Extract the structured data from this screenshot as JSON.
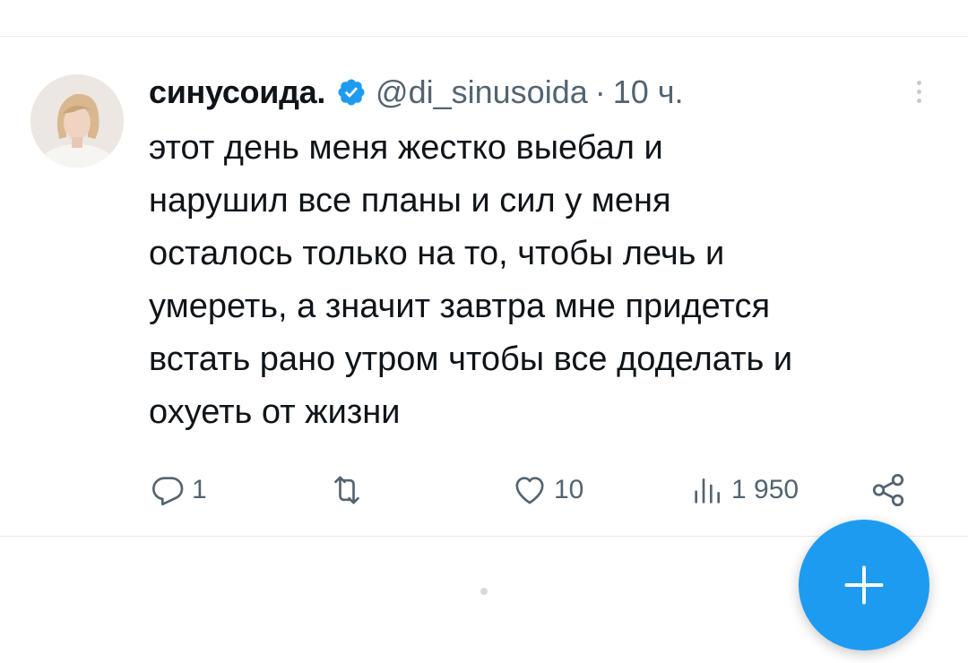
{
  "tweet": {
    "author": {
      "display_name": "синусоида.",
      "handle": "@di_sinusoida",
      "verified": true
    },
    "separator": "·",
    "time": "10 ч.",
    "text_lines": [
      "этот день меня жестко выебал и",
      "нарушил все планы и сил у меня",
      "осталось только на то, чтобы лечь и",
      "умереть, а значит завтра мне придется",
      "встать рано утром чтобы все доделать и",
      "охуеть от жизни"
    ],
    "actions": {
      "reply_count": "1",
      "retweet_count": "",
      "like_count": "10",
      "views_count": "1 950"
    }
  },
  "icons": {
    "more": "more-vertical-icon",
    "verified": "verified-badge-icon",
    "reply": "reply-icon",
    "retweet": "retweet-icon",
    "like": "heart-icon",
    "views": "views-icon",
    "share": "share-icon",
    "compose": "plus-icon"
  },
  "colors": {
    "accent": "#1d9bf0",
    "text": "#0f1419",
    "muted": "#536471"
  }
}
